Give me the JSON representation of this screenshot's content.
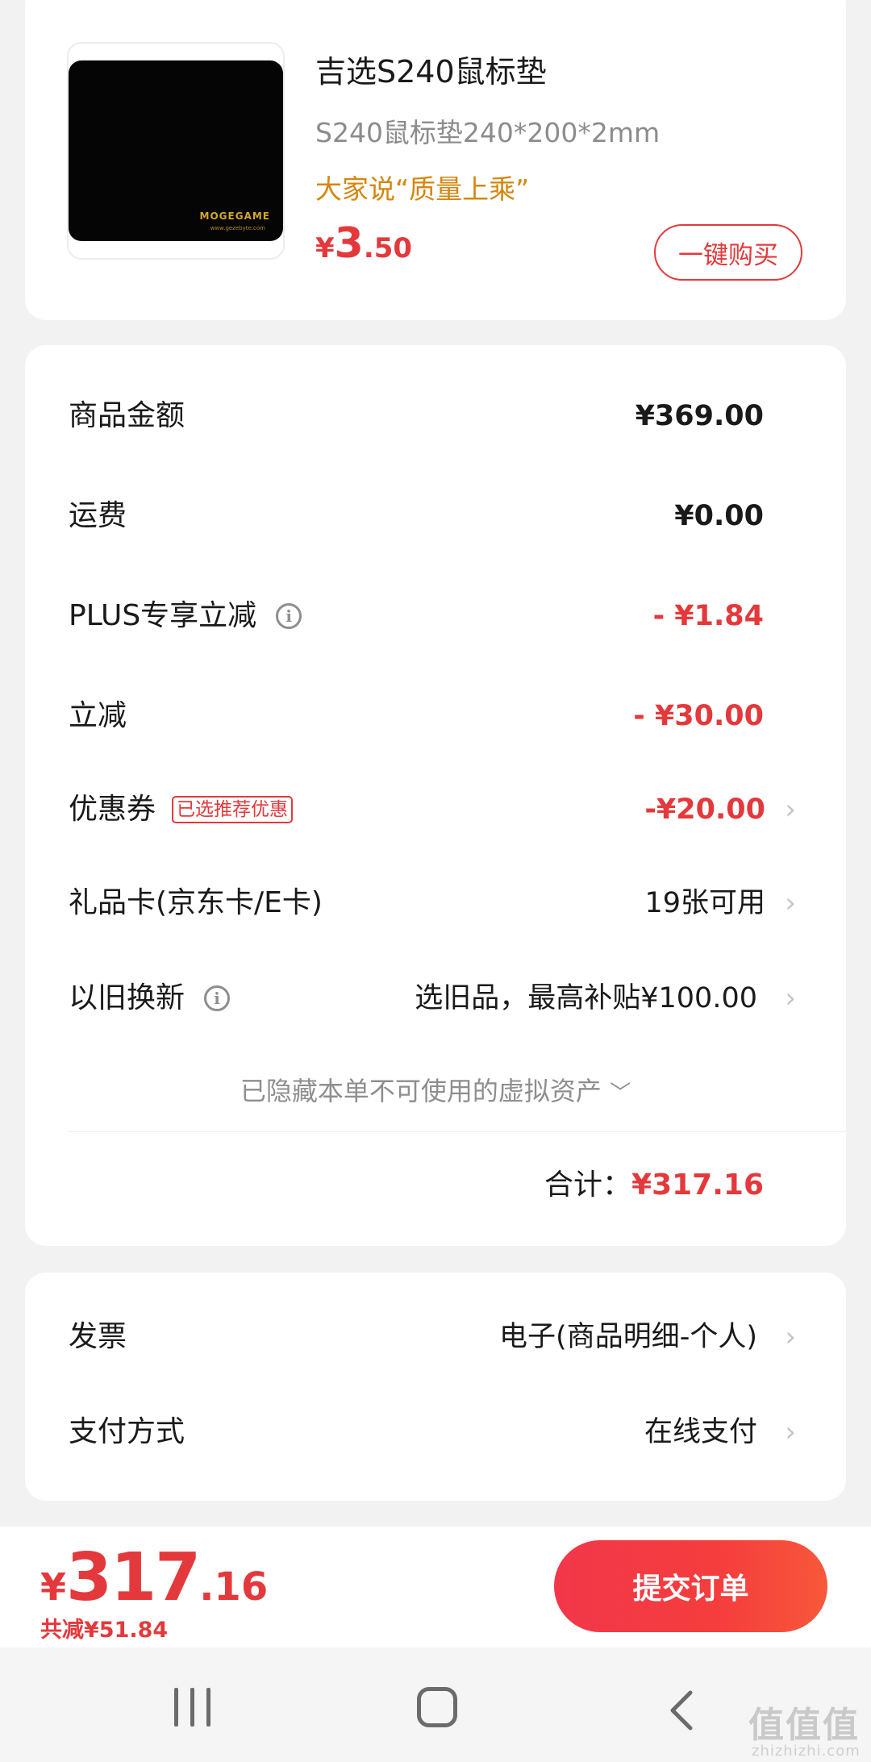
{
  "product": {
    "name": "吉选S240鼠标垫",
    "spec": "S240鼠标垫240*200*2mm",
    "review": "大家说“质量上乘”",
    "price_currency": "¥",
    "price_int": "3",
    "price_dec": ".50",
    "buy_button": "一键购买",
    "image_brand": "MOGEGAME",
    "image_url_text": "www.gezebyte.com"
  },
  "summary": {
    "goods_amount": {
      "label": "商品金额",
      "value": "¥369.00"
    },
    "shipping": {
      "label": "运费",
      "value": "¥0.00"
    },
    "plus_discount": {
      "label": "PLUS专享立减",
      "value": "- ¥1.84"
    },
    "instant_discount": {
      "label": "立减",
      "value": "- ¥30.00"
    },
    "coupon": {
      "label": "优惠券",
      "tag": "已选推荐优惠",
      "value": "-¥20.00"
    },
    "gift_card": {
      "label": "礼品卡(京东卡/E卡)",
      "value": "19张可用"
    },
    "trade_in": {
      "label": "以旧换新",
      "value": "选旧品，最高补贴¥100.00"
    },
    "hidden_assets": "已隐藏本单不可使用的虚拟资产",
    "total_label": "合计：",
    "total_value": "¥317.16"
  },
  "invoice": {
    "invoice": {
      "label": "发票",
      "value": "电子(商品明细-个人)"
    },
    "payment": {
      "label": "支付方式",
      "value": "在线支付"
    }
  },
  "bottom": {
    "currency": "¥",
    "price_int": "317",
    "price_dec": ".16",
    "saved": "共减¥51.84",
    "submit": "提交订单"
  },
  "watermark": {
    "main": "值值值",
    "sub": "zhizhizhi.com"
  },
  "colors": {
    "accent_red": "#e4393c",
    "review_orange": "#d4860f",
    "muted_gray": "#8c8c8c"
  }
}
